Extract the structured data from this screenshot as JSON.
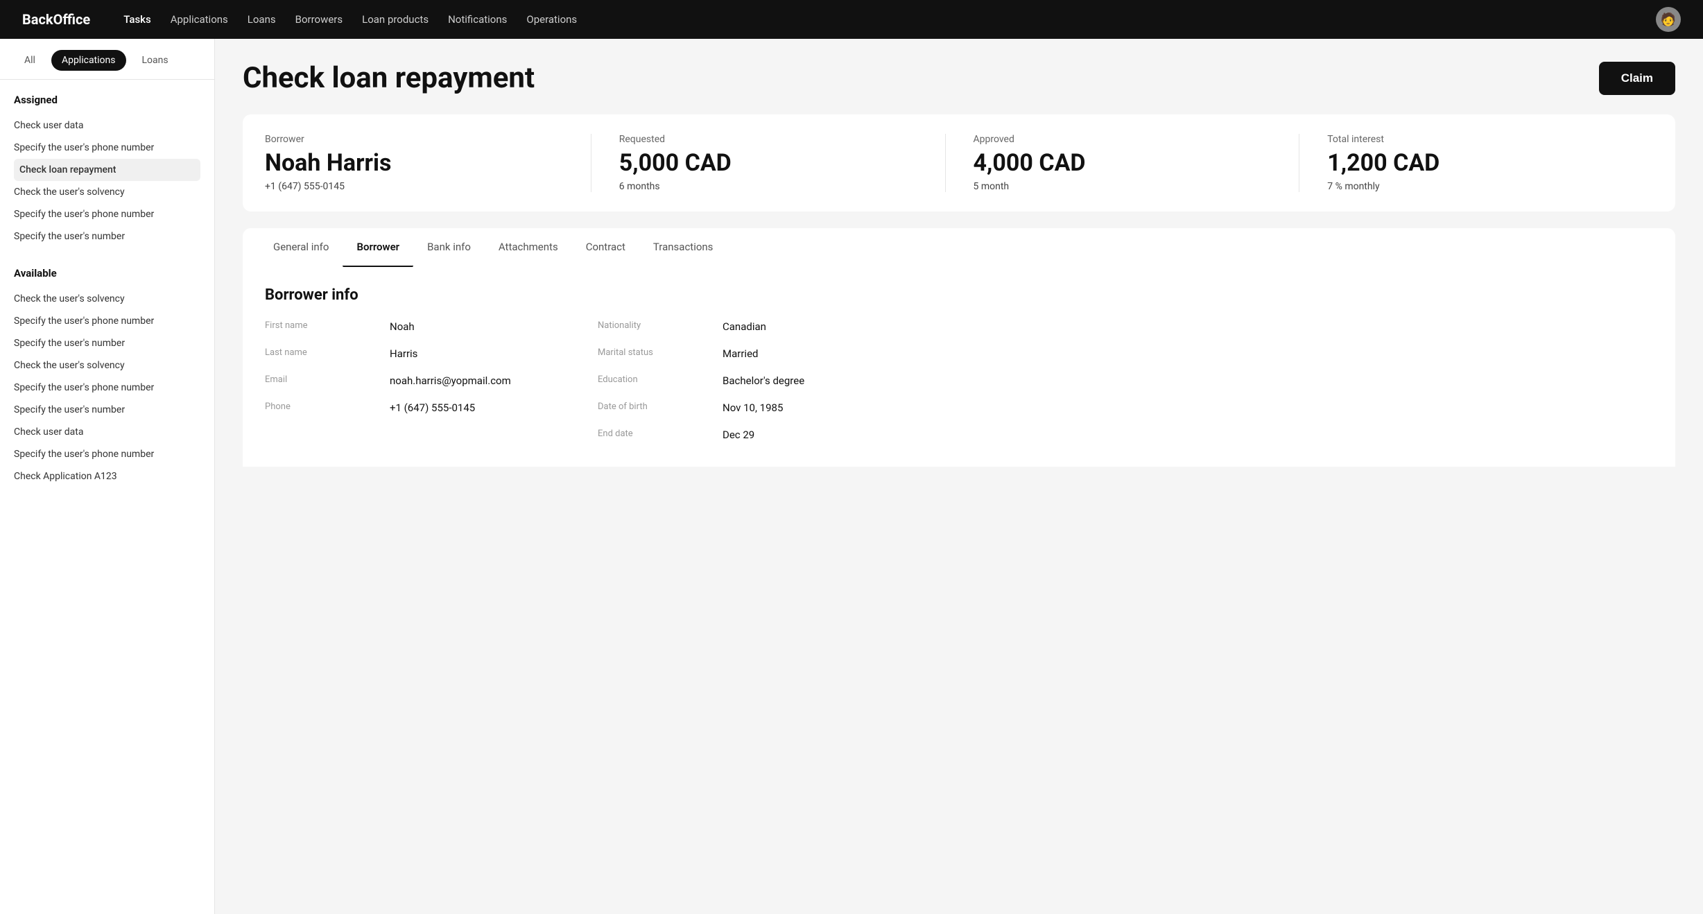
{
  "nav": {
    "logo": "BackOffice",
    "links": [
      {
        "label": "Tasks",
        "active": true
      },
      {
        "label": "Applications",
        "active": false
      },
      {
        "label": "Loans",
        "active": false
      },
      {
        "label": "Borrowers",
        "active": false
      },
      {
        "label": "Loan products",
        "active": false
      },
      {
        "label": "Notifications",
        "active": false
      },
      {
        "label": "Operations",
        "active": false
      }
    ],
    "avatar_emoji": "👤"
  },
  "sidebar": {
    "tabs": [
      {
        "label": "All",
        "active": false
      },
      {
        "label": "Applications",
        "active": true
      },
      {
        "label": "Loans",
        "active": false
      }
    ],
    "sections": [
      {
        "title": "Assigned",
        "items": [
          {
            "label": "Check user data",
            "active": false
          },
          {
            "label": "Specify the user's phone number",
            "active": false
          },
          {
            "label": "Check loan repayment",
            "active": true
          },
          {
            "label": "Check the user's solvency",
            "active": false
          },
          {
            "label": "Specify the user's phone number",
            "active": false
          },
          {
            "label": "Specify the user's number",
            "active": false
          }
        ]
      },
      {
        "title": "Available",
        "items": [
          {
            "label": "Check the user's solvency",
            "active": false
          },
          {
            "label": "Specify the user's phone number",
            "active": false
          },
          {
            "label": "Specify the user's number",
            "active": false
          },
          {
            "label": "Check the user's solvency",
            "active": false
          },
          {
            "label": "Specify the user's phone number",
            "active": false
          },
          {
            "label": "Specify the user's number",
            "active": false
          },
          {
            "label": "Check user data",
            "active": false
          },
          {
            "label": "Specify the user's phone number",
            "active": false
          },
          {
            "label": "Check Application A123",
            "active": false
          }
        ]
      }
    ]
  },
  "page": {
    "title": "Check loan repayment",
    "claim_button": "Claim"
  },
  "borrower_card": {
    "borrower_label": "Borrower",
    "borrower_name": "Noah Harris",
    "borrower_phone": "+1 (647) 555-0145",
    "requested_label": "Requested",
    "requested_amount": "5,000 CAD",
    "requested_sub": "6 months",
    "approved_label": "Approved",
    "approved_amount": "4,000 CAD",
    "approved_sub": "5 month",
    "interest_label": "Total interest",
    "interest_amount": "1,200 CAD",
    "interest_sub": "7 % monthly"
  },
  "detail_tabs": [
    {
      "label": "General info",
      "active": false
    },
    {
      "label": "Borrower",
      "active": true
    },
    {
      "label": "Bank info",
      "active": false
    },
    {
      "label": "Attachments",
      "active": false
    },
    {
      "label": "Contract",
      "active": false
    },
    {
      "label": "Transactions",
      "active": false
    }
  ],
  "borrower_info": {
    "section_title": "Borrower info",
    "fields_left": [
      {
        "label": "First name",
        "value": "Noah"
      },
      {
        "label": "Last name",
        "value": "Harris"
      },
      {
        "label": "Email",
        "value": "noah.harris@yopmail.com"
      },
      {
        "label": "Phone",
        "value": "+1 (647) 555-0145"
      }
    ],
    "fields_right": [
      {
        "label": "Nationality",
        "value": "Canadian"
      },
      {
        "label": "Marital status",
        "value": "Married"
      },
      {
        "label": "Education",
        "value": "Bachelor's degree"
      },
      {
        "label": "Date of birth",
        "value": "Nov 10, 1985"
      },
      {
        "label": "End date",
        "value": "Dec 29"
      }
    ]
  }
}
